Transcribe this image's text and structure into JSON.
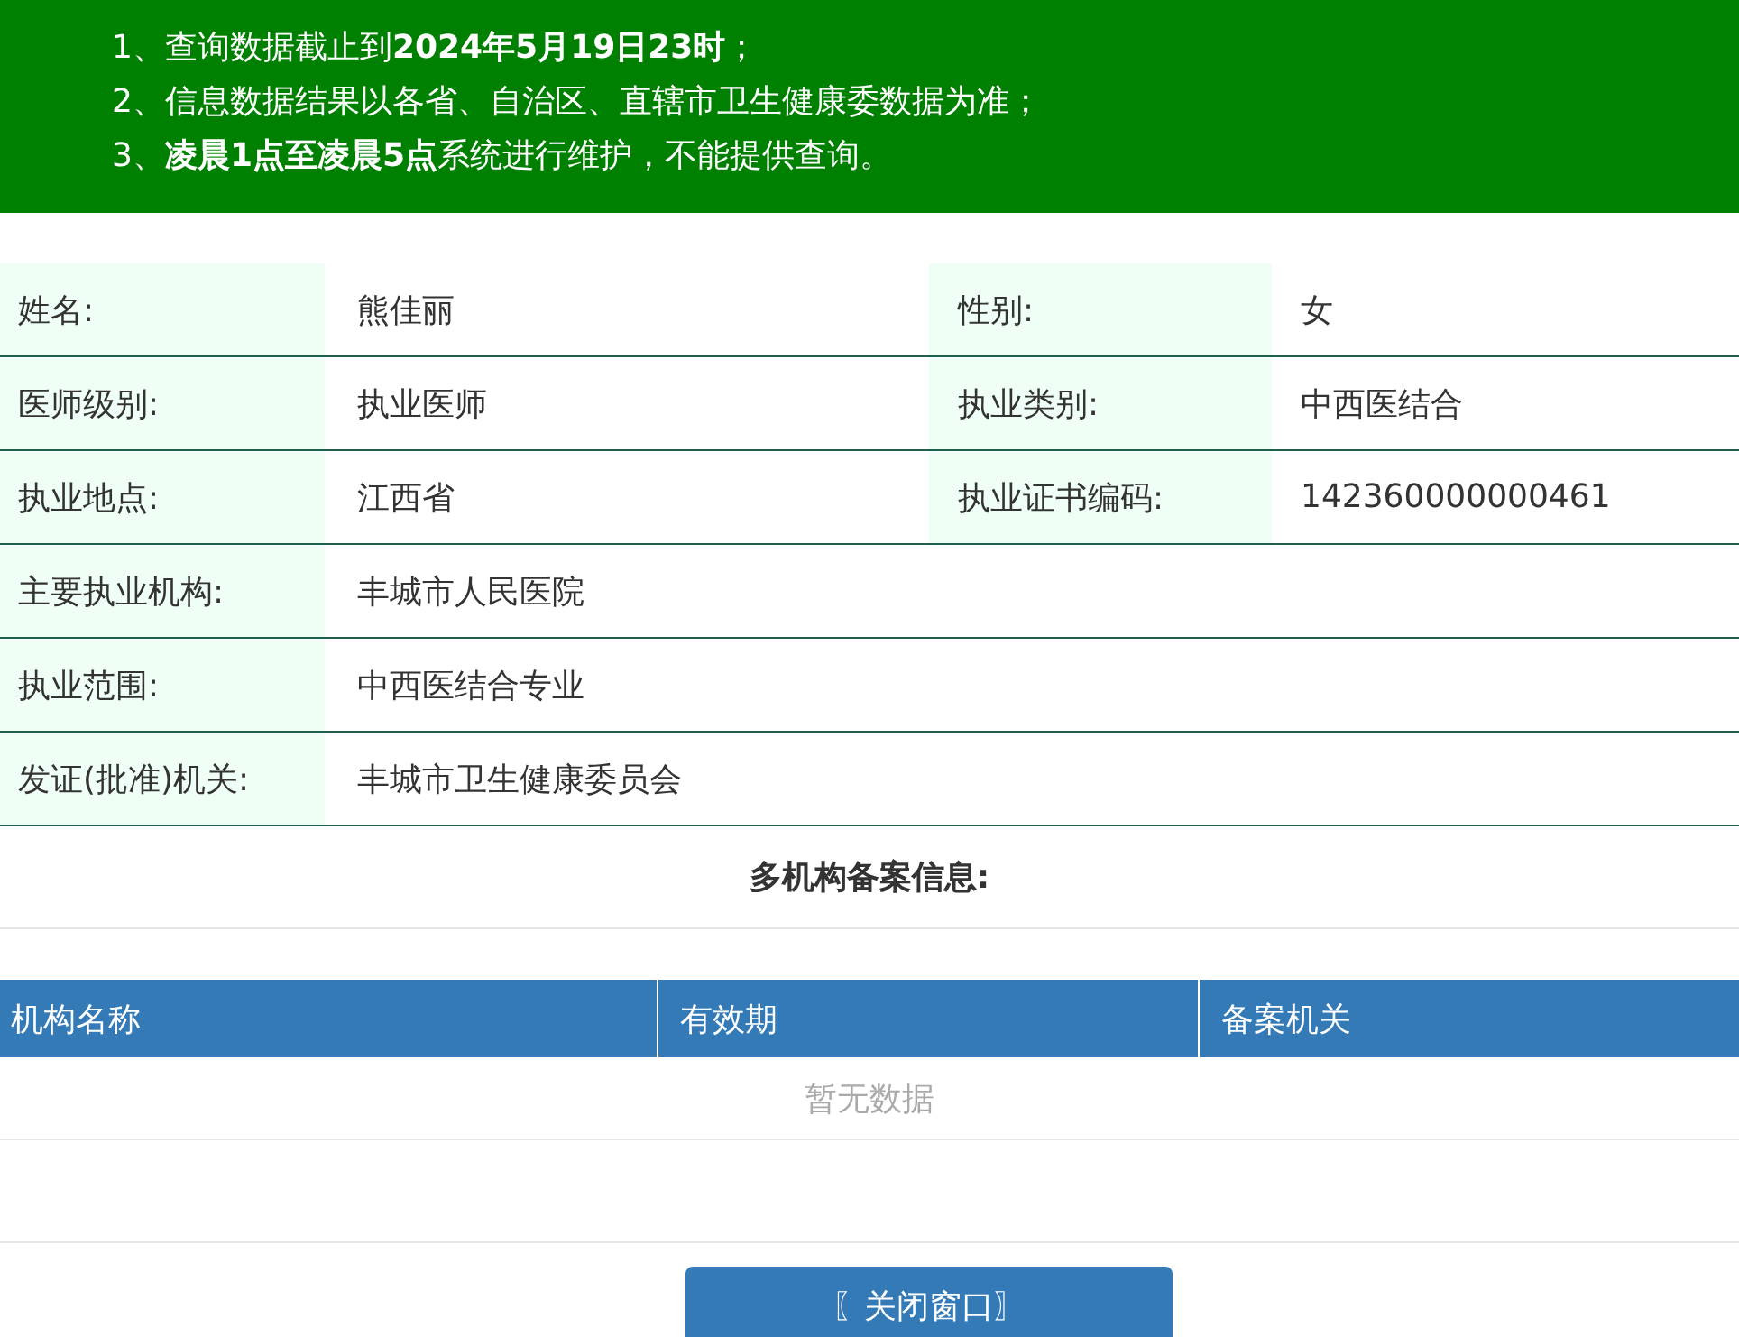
{
  "notices": [
    "1、查询数据截止到**2024年5月19日23时**；",
    "2、信息数据结果以各省、自治区、直辖市卫生健康委数据为准；",
    "3、**凌晨1点至凌晨5点**系统进行维护，不能提供查询。"
  ],
  "info_rows": [
    {
      "fields": [
        {
          "label": "姓名:",
          "value": "熊佳丽"
        },
        {
          "label": "性别:",
          "value": "女"
        }
      ]
    },
    {
      "fields": [
        {
          "label": "医师级别:",
          "value": "执业医师"
        },
        {
          "label": "执业类别:",
          "value": "中西医结合"
        }
      ]
    },
    {
      "fields": [
        {
          "label": "执业地点:",
          "value": "江西省"
        },
        {
          "label": "执业证书编码:",
          "value": "142360000000461"
        }
      ]
    },
    {
      "fields": [
        {
          "label": "主要执业机构:",
          "value": "丰城市人民医院"
        }
      ]
    },
    {
      "fields": [
        {
          "label": "执业范围:",
          "value": "中西医结合专业"
        }
      ]
    },
    {
      "fields": [
        {
          "label": "发证(批准)机关:",
          "value": "丰城市卫生健康委员会"
        }
      ]
    }
  ],
  "multi_section": {
    "title": "多机构备案信息:",
    "columns": [
      "机构名称",
      "有效期",
      "备案机关"
    ],
    "empty_text": "暂无数据"
  },
  "close_button": "〖关闭窗口〗"
}
